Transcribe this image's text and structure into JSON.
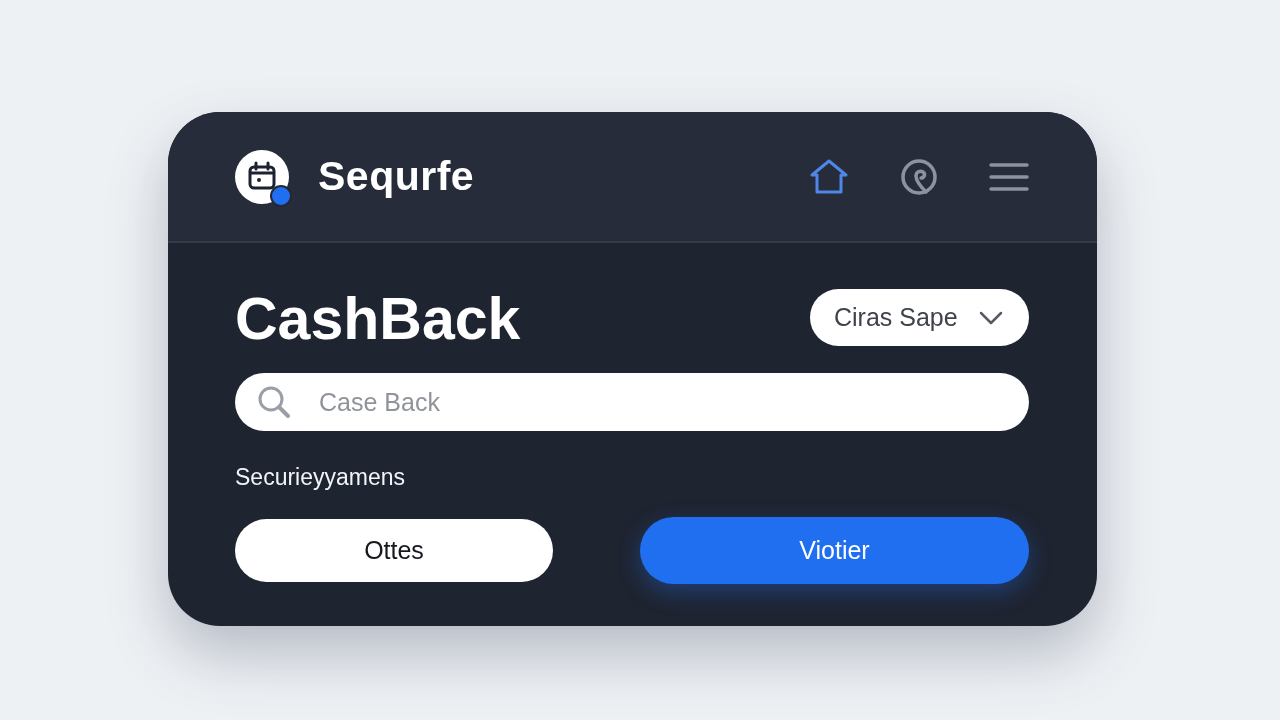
{
  "header": {
    "title": "Sequrfe",
    "nav": [
      {
        "kind": "home",
        "selected": true
      },
      {
        "kind": "spiral",
        "selected": false
      },
      {
        "kind": "menu",
        "selected": false
      }
    ]
  },
  "heading": "CashBack",
  "dropdown": {
    "value": "Ciras Sape"
  },
  "search": {
    "placeholder": "Case Back"
  },
  "label": "Securieyyamens",
  "buttons": [
    {
      "kind": "secondary",
      "label": "Ottes"
    },
    {
      "kind": "primary",
      "label": "Viotier"
    }
  ]
}
